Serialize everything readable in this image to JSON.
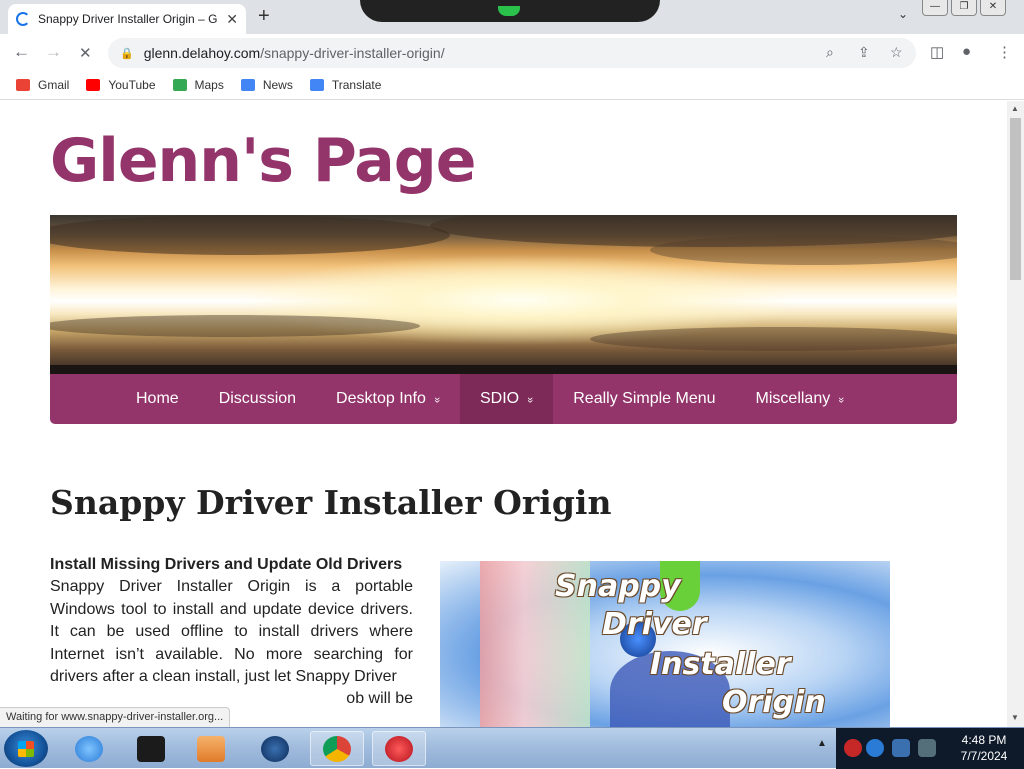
{
  "browser": {
    "tab_title": "Snappy Driver Installer Origin – G",
    "tab_close": "✕",
    "new_tab": "+",
    "tab_dropdown": "⌄",
    "window_buttons": [
      "—",
      "❐",
      "✕"
    ],
    "nav": {
      "back": "←",
      "forward": "→",
      "reload": "✕"
    },
    "url_host": "glenn.delahoy.com",
    "url_path": "/snappy-driver-installer-origin/",
    "lock": "🔒",
    "omni_icons": {
      "zoom": "⌕",
      "share": "⇪",
      "star": "☆"
    },
    "toolbar_icons": {
      "sidepanel": "◫",
      "profile": "●",
      "menu": "⋮"
    },
    "bookmarks": [
      {
        "label": "Gmail",
        "icon": "gmail-icon",
        "color": "#ea4335"
      },
      {
        "label": "YouTube",
        "icon": "youtube-icon",
        "color": "#ff0000"
      },
      {
        "label": "Maps",
        "icon": "maps-icon",
        "color": "#34a853"
      },
      {
        "label": "News",
        "icon": "news-icon",
        "color": "#4285f4"
      },
      {
        "label": "Translate",
        "icon": "translate-icon",
        "color": "#4285f4"
      }
    ],
    "status": "Waiting for www.snappy-driver-installer.org..."
  },
  "page": {
    "site_title": "Glenn's Page",
    "menu": [
      {
        "label": "Home",
        "has_sub": false,
        "active": false
      },
      {
        "label": "Discussion",
        "has_sub": false,
        "active": false
      },
      {
        "label": "Desktop Info",
        "has_sub": true,
        "active": false
      },
      {
        "label": "SDIO",
        "has_sub": true,
        "active": true
      },
      {
        "label": "Really Simple Menu",
        "has_sub": false,
        "active": false
      },
      {
        "label": "Miscellany",
        "has_sub": true,
        "active": false
      }
    ],
    "submenu_arrow": "»",
    "heading": "Snappy Driver Installer Origin",
    "intro_bold": "Install Missing Drivers and Update Old Drivers",
    "intro_text": "Snappy Driver Installer Origin is a portable Windows tool to install and update device drivers. It can be used offline to install drivers where Internet isn’t available. No more searching for drivers after a clean install, just let Snappy Driver",
    "intro_tail": "ob will be",
    "logo_words": [
      "Snappy",
      "Driver",
      "Installer",
      "Origin"
    ],
    "colors": {
      "accent": "#93346a",
      "accent_active": "#7d2a59"
    }
  },
  "taskbar": {
    "apps": [
      {
        "name": "ie-icon",
        "color": "#2a7bd6",
        "active": false
      },
      {
        "name": "drive-icon",
        "color": "#1b1b1b",
        "active": false
      },
      {
        "name": "media-player-icon",
        "color": "#e07b2a",
        "active": false
      },
      {
        "name": "globe-icon",
        "color": "#0c2c5a",
        "active": false
      },
      {
        "name": "chrome-icon",
        "color": "#db4437",
        "active": true
      },
      {
        "name": "app-red-icon",
        "color": "#b3121e",
        "active": true
      }
    ],
    "tray_up": "▲",
    "tray_icons": [
      {
        "name": "tray-red-icon",
        "color": "#c62828"
      },
      {
        "name": "tray-ie-icon",
        "color": "#2a7bd6"
      },
      {
        "name": "tray-monitor-icon",
        "color": "#3a6fb0"
      },
      {
        "name": "tray-shield-icon",
        "color": "#546e7a"
      }
    ],
    "time": "4:48 PM",
    "date": "7/7/2024"
  }
}
